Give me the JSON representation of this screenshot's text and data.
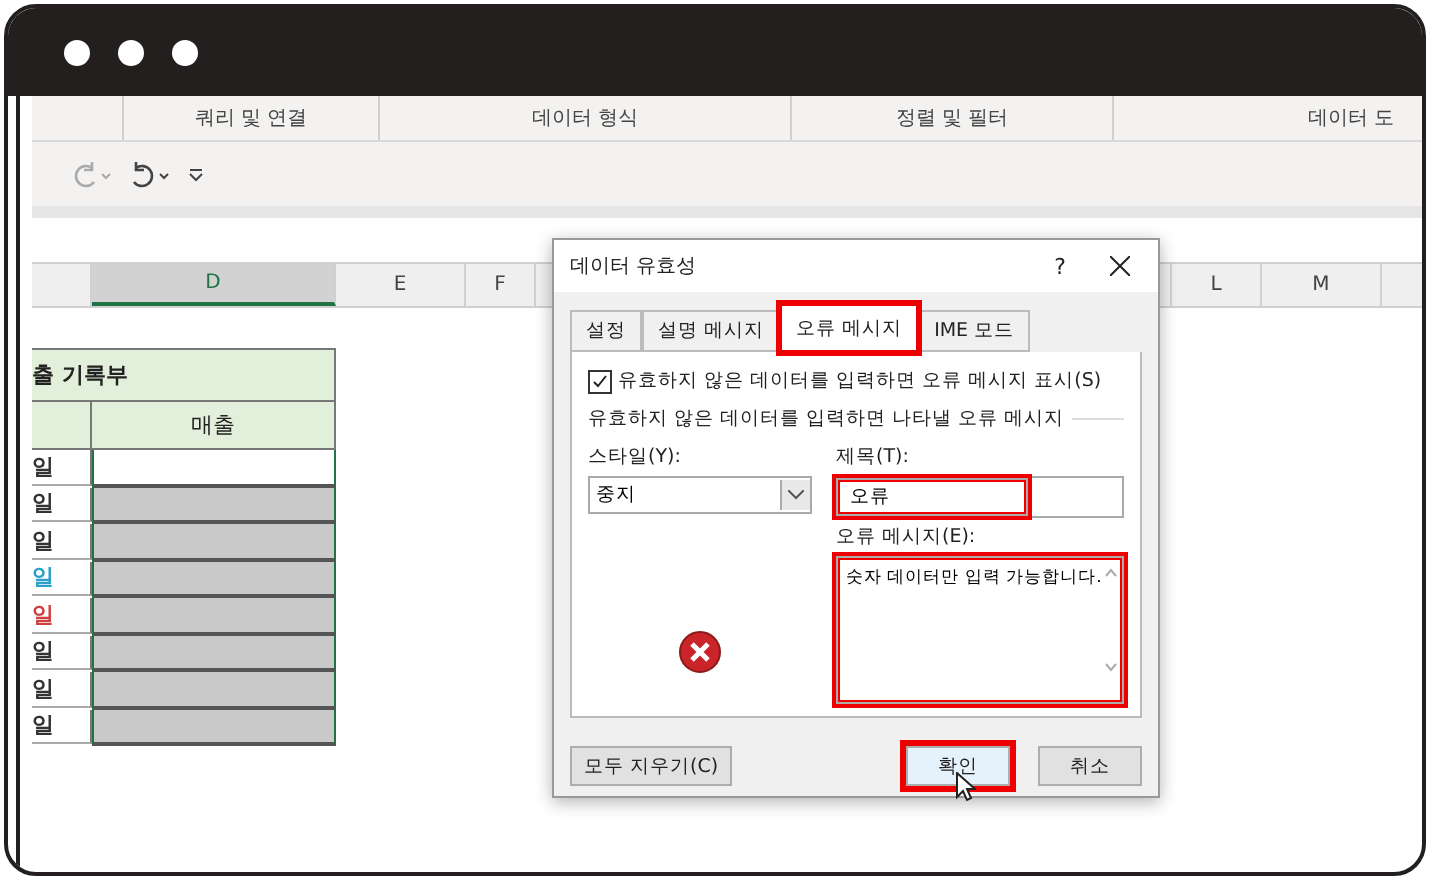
{
  "ribbon_groups": [
    {
      "label": "쿼리 및 연결"
    },
    {
      "label": "데이터 형식"
    },
    {
      "label": "정렬 및 필터"
    },
    {
      "label": "데이터 도"
    }
  ],
  "columns": [
    {
      "label": "D",
      "selected": true
    },
    {
      "label": "E",
      "selected": false
    },
    {
      "label": "F",
      "selected": false
    },
    {
      "label": "L",
      "selected": false
    },
    {
      "label": "M",
      "selected": false
    }
  ],
  "sheet": {
    "title": "출 기록부",
    "header": "매출",
    "rows": [
      {
        "label": "일",
        "color": "#333333",
        "selected": false
      },
      {
        "label": "일",
        "color": "#333333",
        "selected": true
      },
      {
        "label": "일",
        "color": "#333333",
        "selected": true
      },
      {
        "label": "일",
        "color": "#2aa0c8",
        "selected": true
      },
      {
        "label": "일",
        "color": "#d04040",
        "selected": true
      },
      {
        "label": "일",
        "color": "#333333",
        "selected": true
      },
      {
        "label": "일",
        "color": "#333333",
        "selected": true
      },
      {
        "label": "일",
        "color": "#333333",
        "selected": true
      }
    ]
  },
  "dialog": {
    "title": "데이터 유효성",
    "help": "?",
    "tabs": [
      {
        "label": "설정",
        "selected": false,
        "highlighted": false
      },
      {
        "label": "설명 메시지",
        "selected": false,
        "highlighted": false
      },
      {
        "label": "오류 메시지",
        "selected": true,
        "highlighted": true
      },
      {
        "label": "IME 모드",
        "selected": false,
        "highlighted": false
      }
    ],
    "show_error": {
      "label": "유효하지 않은 데이터를 입력하면 오류 메시지 표시(S)",
      "checked": true
    },
    "group_label": "유효하지 않은 데이터를 입력하면 나타낼 오류 메시지",
    "style": {
      "label": "스타일(Y):",
      "value": "중지"
    },
    "title_field": {
      "label": "제목(T):",
      "value": "오류",
      "highlighted": true
    },
    "message_field": {
      "label": "오류 메시지(E):",
      "value": "숫자 데이터만 입력 가능합니다.",
      "highlighted": true
    },
    "buttons": [
      {
        "label": "모두 지우기(C)",
        "highlighted": false
      },
      {
        "label": "확인",
        "highlighted": true
      },
      {
        "label": "취소",
        "highlighted": false
      }
    ]
  }
}
